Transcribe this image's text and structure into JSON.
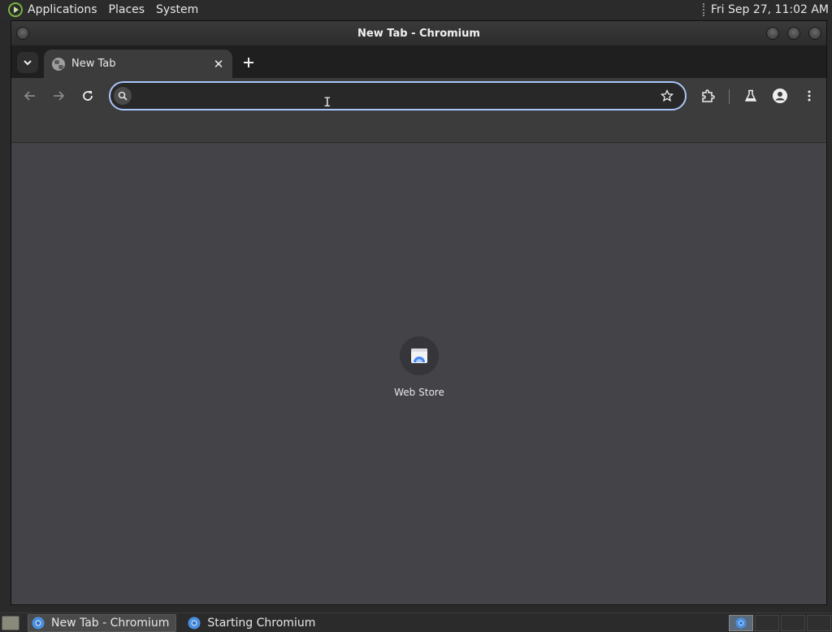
{
  "top_panel": {
    "menus": [
      "Applications",
      "Places",
      "System"
    ],
    "clock": "Fri Sep 27, 11:02 AM"
  },
  "window": {
    "title": "New Tab - Chromium"
  },
  "tabs": [
    {
      "label": "New Tab",
      "icon": "globe-icon",
      "active": true
    }
  ],
  "toolbar": {
    "omnibox_value": "",
    "omnibox_placeholder": ""
  },
  "content": {
    "shortcuts": [
      {
        "label": "Web Store",
        "icon": "web-store-icon"
      }
    ]
  },
  "taskbar": {
    "tasks": [
      {
        "label": "New Tab - Chromium",
        "active": true
      },
      {
        "label": "Starting Chromium",
        "active": false
      }
    ]
  },
  "colors": {
    "accent": "#a8c7fa",
    "content_bg": "#434348",
    "toolbar_bg": "#3c3c3c"
  }
}
